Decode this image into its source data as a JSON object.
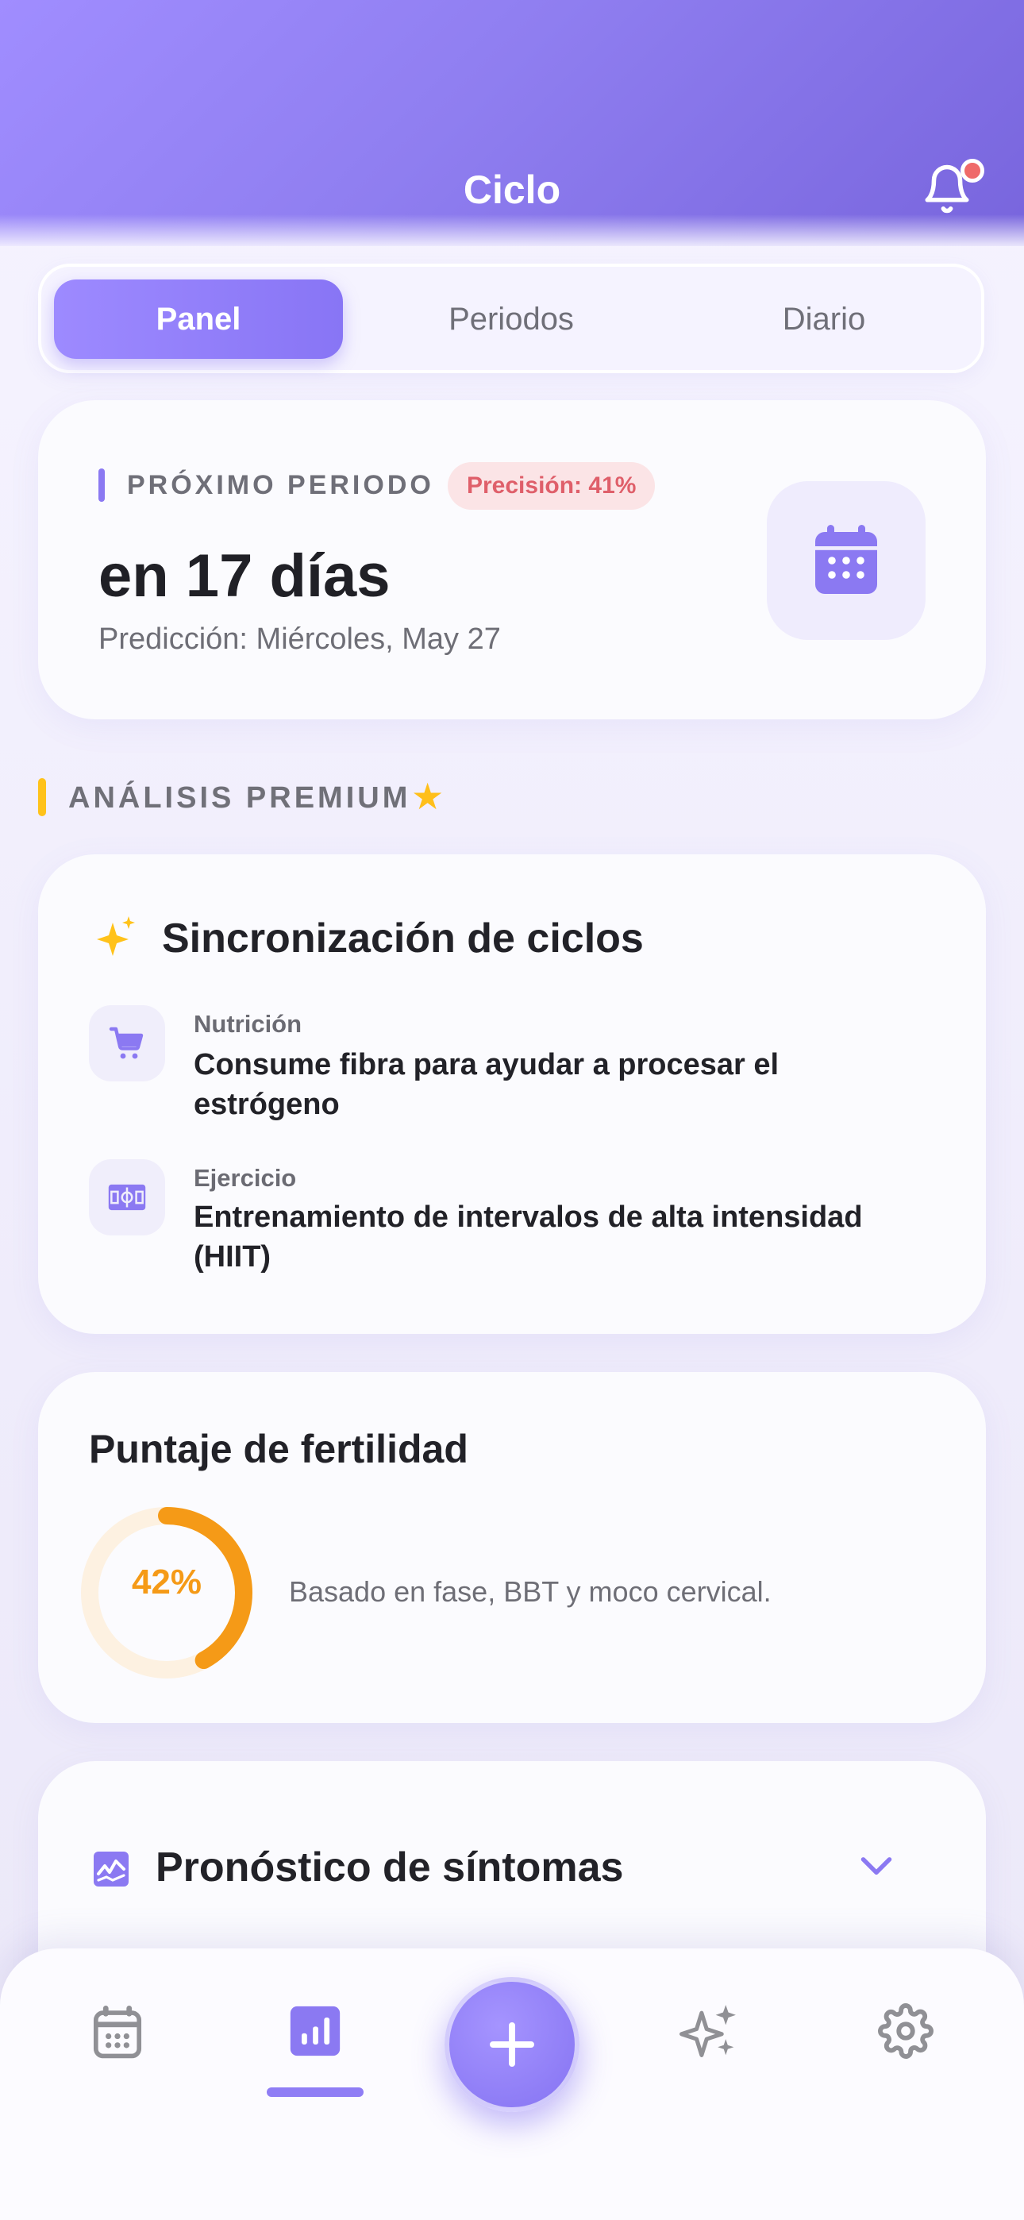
{
  "header": {
    "title": "Ciclo"
  },
  "tabs": [
    {
      "label": "Panel"
    },
    {
      "label": "Periodos"
    },
    {
      "label": "Diario"
    }
  ],
  "next_period": {
    "label": "PRÓXIMO PERIODO",
    "precision": "Precisión: 41%",
    "days": "en 17 días",
    "prediction": "Predicción: Miércoles, May 27"
  },
  "premium": {
    "label": "ANÁLISIS PREMIUM"
  },
  "sync": {
    "title": "Sincronización de ciclos",
    "items": [
      {
        "category": "Nutrición",
        "text": "Consume fibra para ayudar a procesar el estrógeno",
        "icon": "cart-icon"
      },
      {
        "category": "Ejercicio",
        "text": "Entrenamiento de intervalos de alta intensidad (HIIT)",
        "icon": "stadium-icon"
      }
    ]
  },
  "fertility": {
    "title": "Puntaje de fertilidad",
    "score": 42,
    "score_label": "42%",
    "description": "Basado en fase, BBT y moco cervical."
  },
  "forecast": {
    "title": "Pronóstico de síntomas"
  },
  "nav": {
    "items": [
      "calendar-icon",
      "chart-icon",
      "plus-icon",
      "sparkles-icon",
      "gear-icon"
    ],
    "active": "chart-icon"
  },
  "colors": {
    "accent": "#8b79f2",
    "precision_badge": "#df5f6a",
    "premium": "#ffc21a",
    "fertility": "#f59a17"
  }
}
